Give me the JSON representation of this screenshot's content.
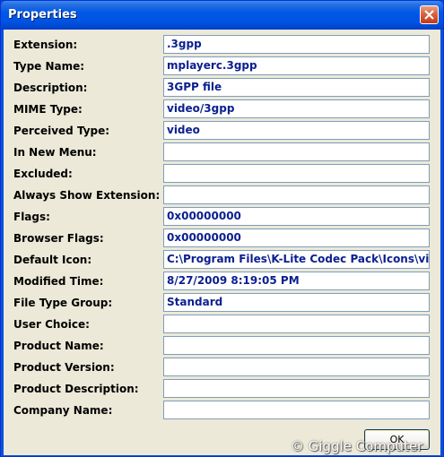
{
  "window": {
    "title": "Properties"
  },
  "fields": [
    {
      "label": "Extension:",
      "value": ".3gpp"
    },
    {
      "label": "Type Name:",
      "value": "mplayerc.3gpp"
    },
    {
      "label": "Description:",
      "value": "3GPP file"
    },
    {
      "label": "MIME Type:",
      "value": "video/3gpp"
    },
    {
      "label": "Perceived Type:",
      "value": "video"
    },
    {
      "label": "In New Menu:",
      "value": ""
    },
    {
      "label": "Excluded:",
      "value": ""
    },
    {
      "label": "Always Show Extension:",
      "value": ""
    },
    {
      "label": "Flags:",
      "value": "0x00000000"
    },
    {
      "label": "Browser Flags:",
      "value": "0x00000000"
    },
    {
      "label": "Default Icon:",
      "value": "C:\\Program Files\\K-Lite Codec Pack\\Icons\\vid"
    },
    {
      "label": "Modified Time:",
      "value": "8/27/2009 8:19:05 PM"
    },
    {
      "label": "File Type Group:",
      "value": "Standard"
    },
    {
      "label": "User Choice:",
      "value": ""
    },
    {
      "label": "Product Name:",
      "value": ""
    },
    {
      "label": "Product Version:",
      "value": ""
    },
    {
      "label": "Product Description:",
      "value": ""
    },
    {
      "label": "Company Name:",
      "value": ""
    }
  ],
  "buttons": {
    "ok": "OK"
  },
  "watermark": "© Giggle Computer",
  "icons": {
    "close": "close-icon"
  }
}
